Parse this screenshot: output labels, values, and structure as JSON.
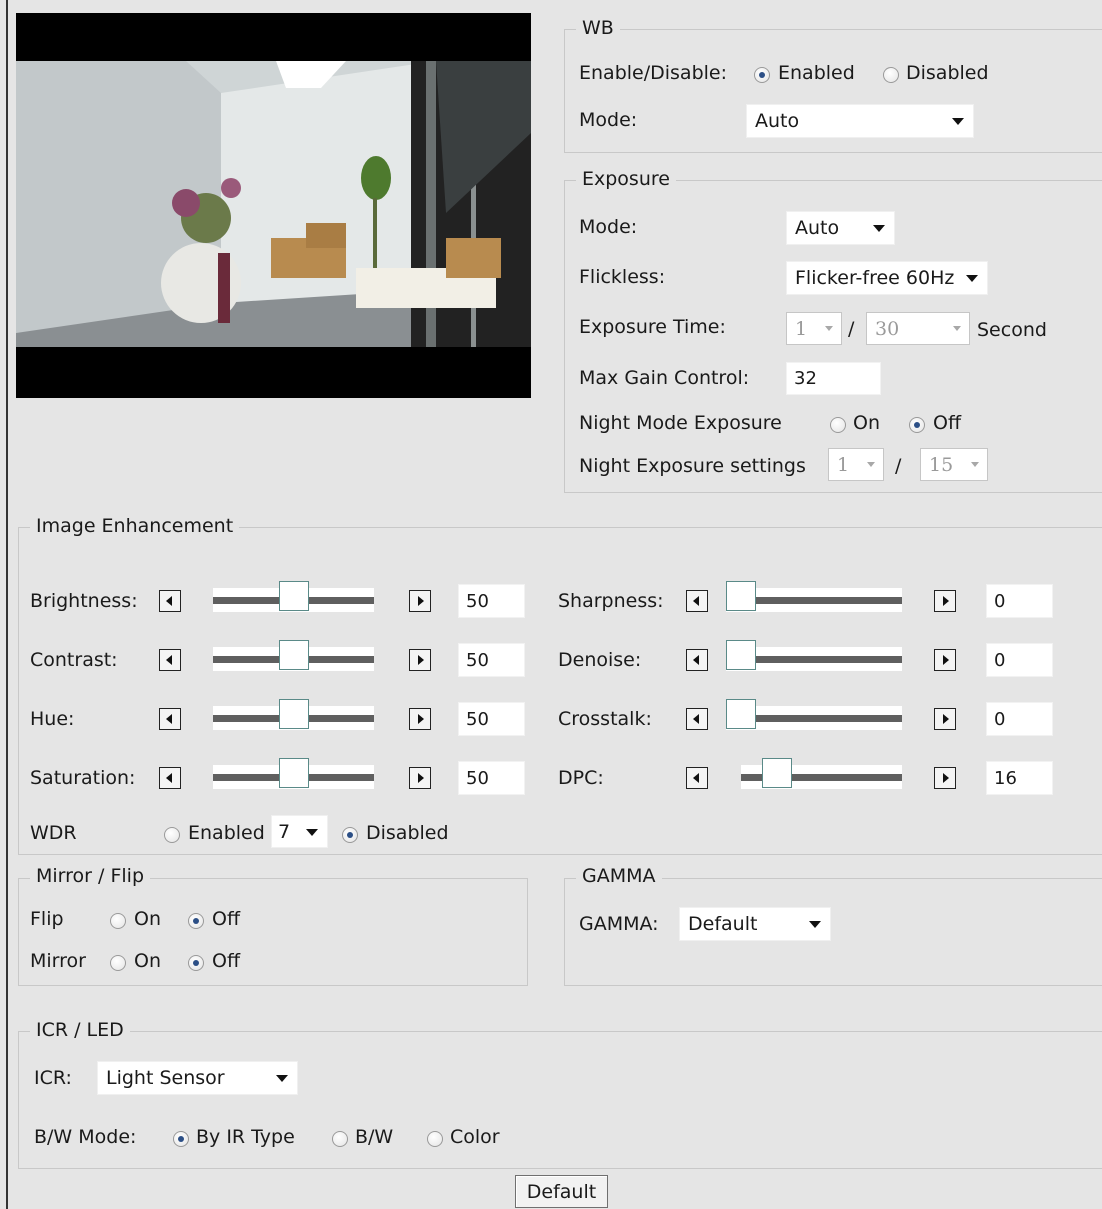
{
  "wb": {
    "legend": "WB",
    "enable_label": "Enable/Disable:",
    "enabled_label": "Enabled",
    "disabled_label": "Disabled",
    "enabled": true,
    "mode_label": "Mode:",
    "mode_value": "Auto"
  },
  "exposure": {
    "legend": "Exposure",
    "mode_label": "Mode:",
    "mode_value": "Auto",
    "flickless_label": "Flickless:",
    "flickless_value": "Flicker-free 60Hz",
    "time_label": "Exposure Time:",
    "time_num": "1",
    "time_slash": "/",
    "time_den": "30",
    "time_unit": "Second",
    "gain_label": "Max Gain Control:",
    "gain_value": "32",
    "night_label": "Night Mode Exposure",
    "on_label": "On",
    "off_label": "Off",
    "night_on": false,
    "night_settings_label": "Night Exposure settings",
    "night_num": "1",
    "night_slash": "/",
    "night_den": "15"
  },
  "enhancement": {
    "legend": "Image Enhancement",
    "left": [
      {
        "label": "Brightness:",
        "value": "50",
        "level": 0.5
      },
      {
        "label": "Contrast:",
        "value": "50",
        "level": 0.5
      },
      {
        "label": "Hue:",
        "value": "50",
        "level": 0.5
      },
      {
        "label": "Saturation:",
        "value": "50",
        "level": 0.5
      }
    ],
    "right": [
      {
        "label": "Sharpness:",
        "value": "0",
        "level": 0
      },
      {
        "label": "Denoise:",
        "value": "0",
        "level": 0
      },
      {
        "label": "Crosstalk:",
        "value": "0",
        "level": 0
      },
      {
        "label": "DPC:",
        "value": "16",
        "level": 0.16
      }
    ],
    "wdr_label": "WDR",
    "wdr_enabled_label": "Enabled",
    "wdr_level": "7",
    "wdr_disabled_label": "Disabled",
    "wdr_enabled": false
  },
  "mirror": {
    "legend": "Mirror / Flip",
    "flip_label": "Flip",
    "mirror_label": "Mirror",
    "on_label": "On",
    "off_label": "Off",
    "flip_on": false,
    "mirror_on": false
  },
  "gamma": {
    "legend": "GAMMA",
    "label": "GAMMA:",
    "value": "Default"
  },
  "icr": {
    "legend": "ICR / LED",
    "icr_label": "ICR:",
    "icr_value": "Light Sensor",
    "bw_label": "B/W Mode:",
    "by_ir_label": "By IR Type",
    "bw_opt_label": "B/W",
    "color_label": "Color",
    "bw_mode": "By IR Type"
  },
  "default_button": "Default"
}
